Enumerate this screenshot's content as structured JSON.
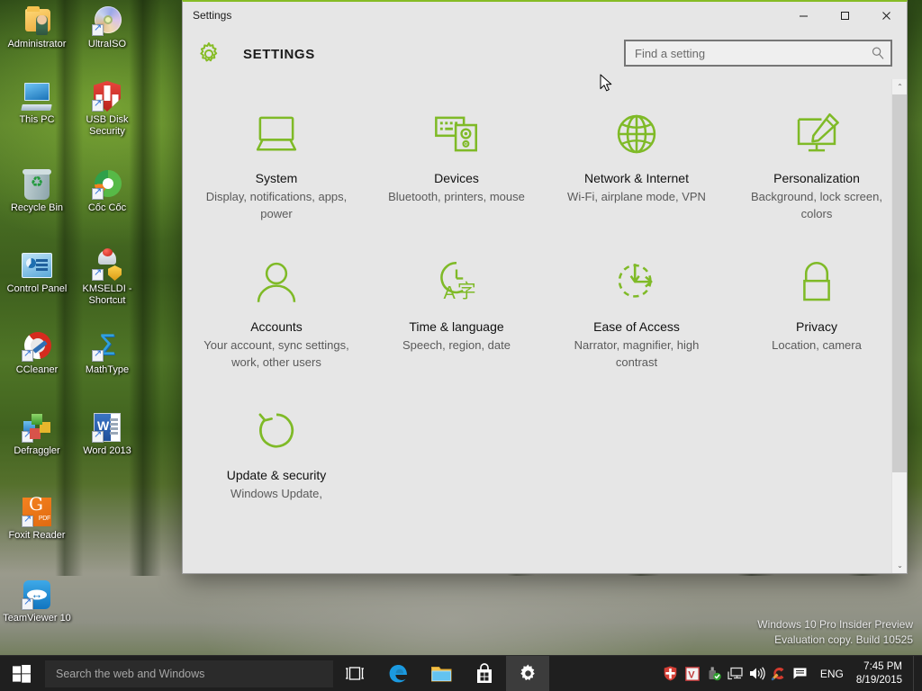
{
  "desktop": {
    "icons": [
      {
        "label": "Administrator",
        "icon": "user-folder-icon",
        "shortcut": false
      },
      {
        "label": "UltraISO",
        "icon": "disc-icon",
        "shortcut": true
      },
      {
        "label": "This PC",
        "icon": "computer-icon",
        "shortcut": false
      },
      {
        "label": "USB Disk Security",
        "icon": "shield-icon",
        "shortcut": true
      },
      {
        "label": "Recycle Bin",
        "icon": "recycle-bin-icon",
        "shortcut": false
      },
      {
        "label": "Cốc Cốc",
        "icon": "coccoc-browser-icon",
        "shortcut": true
      },
      {
        "label": "Control Panel",
        "icon": "control-panel-icon",
        "shortcut": false
      },
      {
        "label": "KMSELDI - Shortcut",
        "icon": "kms-icon",
        "shortcut": true
      },
      {
        "label": "CCleaner",
        "icon": "ccleaner-icon",
        "shortcut": true
      },
      {
        "label": "MathType",
        "icon": "mathtype-icon",
        "shortcut": true
      },
      {
        "label": "Defraggler",
        "icon": "defraggler-icon",
        "shortcut": true
      },
      {
        "label": "Word 2013",
        "icon": "word-icon",
        "shortcut": true
      },
      {
        "label": "Foxit Reader",
        "icon": "foxit-reader-icon",
        "shortcut": true
      },
      {
        "label": "TeamViewer 10",
        "icon": "teamviewer-icon",
        "shortcut": true
      }
    ]
  },
  "watermark": {
    "line1": "Windows 10 Pro Insider Preview",
    "line2": "Evaluation copy. Build 10525"
  },
  "window": {
    "title": "Settings",
    "minimize_label": "─",
    "maximize_label": "☐",
    "close_label": "✕",
    "accent_color": "#86bc25",
    "header_title": "SETTINGS",
    "gear_icon": "gear-icon",
    "search": {
      "placeholder": "Find a setting",
      "value": "",
      "icon": "search-icon"
    },
    "scrollbar": {
      "up_arrow": "⌃",
      "down_arrow": "⌄"
    },
    "tiles": [
      {
        "name": "System",
        "desc": "Display, notifications, apps, power",
        "icon": "laptop-icon"
      },
      {
        "name": "Devices",
        "desc": "Bluetooth, printers, mouse",
        "icon": "devices-icon"
      },
      {
        "name": "Network & Internet",
        "desc": "Wi-Fi, airplane mode, VPN",
        "icon": "globe-icon"
      },
      {
        "name": "Personalization",
        "desc": "Background, lock screen, colors",
        "icon": "paintbrush-monitor-icon"
      },
      {
        "name": "Accounts",
        "desc": "Your account, sync settings, work, other users",
        "icon": "person-icon"
      },
      {
        "name": "Time & language",
        "desc": "Speech, region, date",
        "icon": "clock-language-icon"
      },
      {
        "name": "Ease of Access",
        "desc": "Narrator, magnifier, high contrast",
        "icon": "ease-of-access-icon"
      },
      {
        "name": "Privacy",
        "desc": "Location, camera",
        "icon": "lock-icon"
      },
      {
        "name": "Update & security",
        "desc": "Windows Update,",
        "icon": "refresh-icon"
      }
    ]
  },
  "taskbar": {
    "start_label": "start-button",
    "search_placeholder": "Search the web and Windows",
    "buttons": [
      {
        "name": "task-view",
        "label": "task-view-icon"
      },
      {
        "name": "edge",
        "label": "edge-browser-icon"
      },
      {
        "name": "file-explorer",
        "label": "file-explorer-icon"
      },
      {
        "name": "store",
        "label": "store-icon"
      },
      {
        "name": "settings",
        "label": "settings-gear-icon"
      }
    ],
    "tray": [
      {
        "name": "usb-disk-security-tray",
        "icon": "shield-icon"
      },
      {
        "name": "vcard-tray",
        "icon": "v-letter-icon"
      },
      {
        "name": "usb-safely-remove-tray",
        "icon": "usb-check-icon"
      },
      {
        "name": "network-tray",
        "icon": "network-icon"
      },
      {
        "name": "volume-tray",
        "icon": "speaker-icon"
      },
      {
        "name": "ccleaner-tray",
        "icon": "ccleaner-icon"
      },
      {
        "name": "action-center-tray",
        "icon": "action-center-icon"
      }
    ],
    "language": "ENG",
    "time": "7:45 PM",
    "date": "8/19/2015"
  }
}
